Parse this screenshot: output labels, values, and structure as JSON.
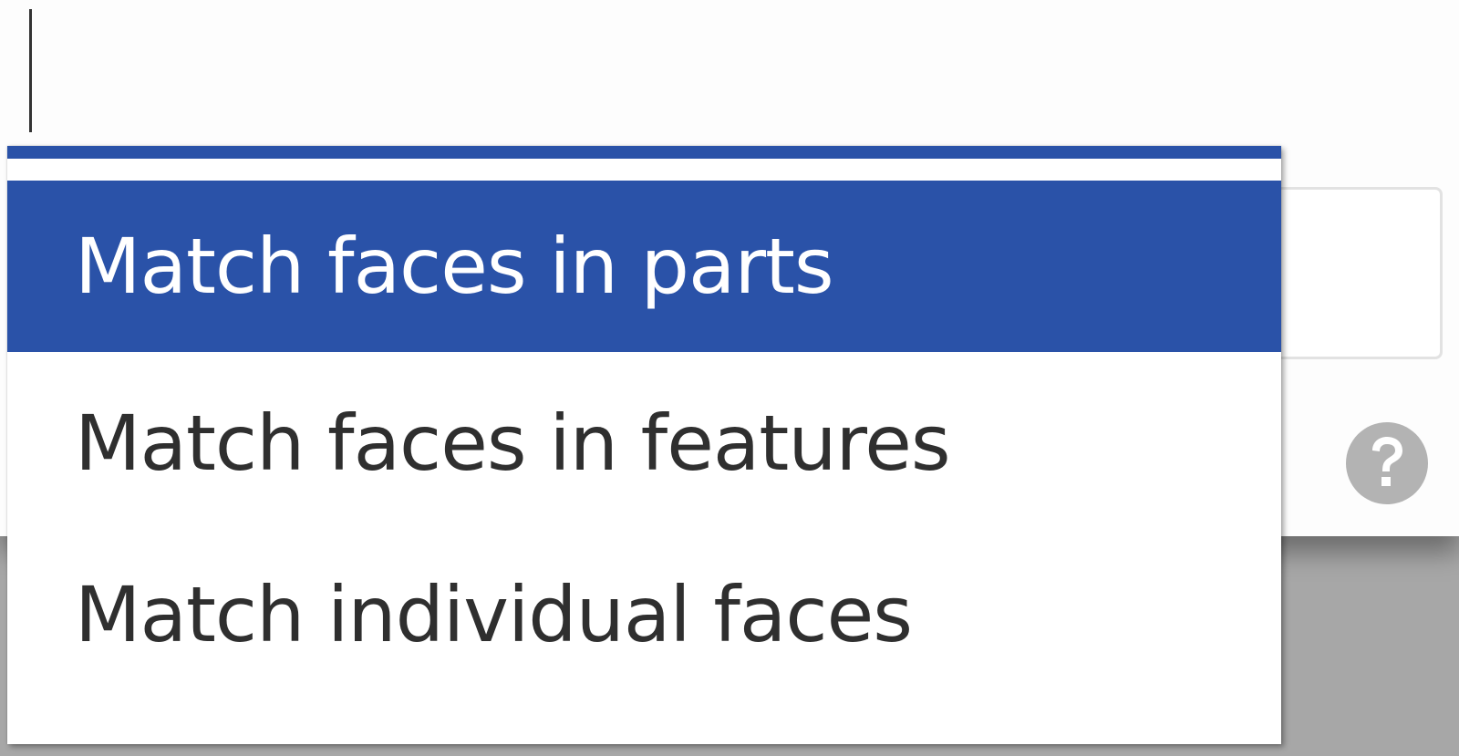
{
  "dropdown": {
    "options": [
      {
        "label": "Match faces in parts",
        "selected": true
      },
      {
        "label": "Match faces in features",
        "selected": false
      },
      {
        "label": "Match individual faces",
        "selected": false
      }
    ]
  },
  "icons": {
    "help": "help-icon"
  },
  "colors": {
    "accent": "#2a52a8",
    "option_text": "#2f2f2f",
    "selected_text": "#ffffff",
    "backdrop": "#a7a7a7",
    "help_icon": "#b3b3b3"
  }
}
